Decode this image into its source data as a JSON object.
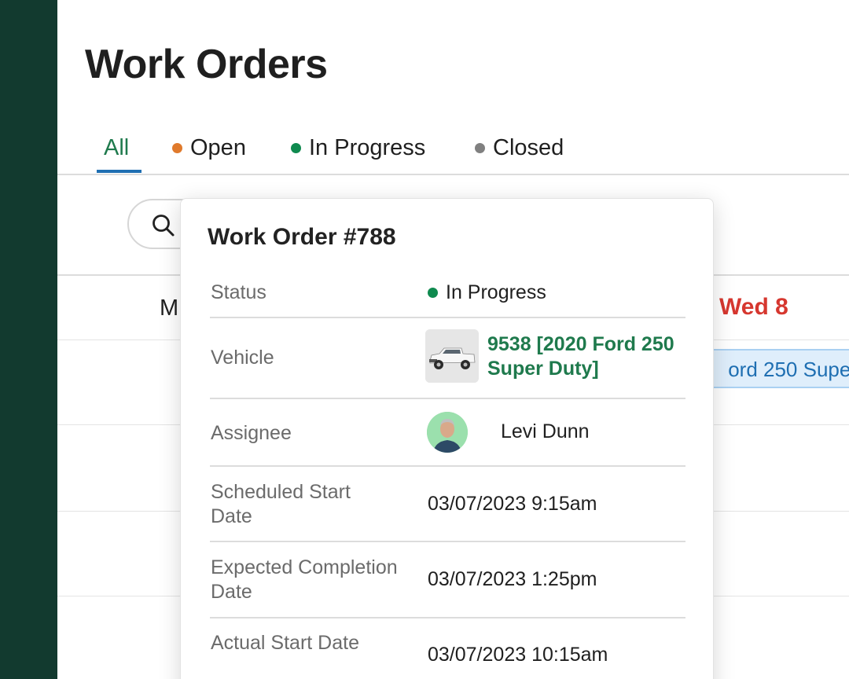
{
  "page": {
    "title": "Work Orders"
  },
  "tabs": [
    {
      "label": "All",
      "dot_color": null,
      "active": true
    },
    {
      "label": "Open",
      "dot_color": "#e07a2c",
      "active": false
    },
    {
      "label": "In Progress",
      "dot_color": "#0f8a4f",
      "active": false
    },
    {
      "label": "Closed",
      "dot_color": "#808080",
      "active": false
    }
  ],
  "search": {
    "icon": "search-icon"
  },
  "calendar": {
    "day_left_partial": "M",
    "day_wed": "Wed 8",
    "event_text": "ord 250 Super"
  },
  "popover": {
    "title": "Work Order #788",
    "rows": {
      "status": {
        "label": "Status",
        "value": "In Progress",
        "dot_color": "#0f8a4f"
      },
      "vehicle": {
        "label": "Vehicle",
        "value": "9538 [2020 Ford 250 Super Duty]",
        "thumb_icon": "pickup-truck-photo"
      },
      "assignee": {
        "label": "Assignee",
        "value": "Levi Dunn",
        "avatar": "avatar-photo"
      },
      "scheduled_start": {
        "label": "Scheduled Start Date",
        "value": "03/07/2023 9:15am"
      },
      "expected_completion": {
        "label": "Expected Completion Date",
        "value": "03/07/2023 1:25pm"
      },
      "actual_start": {
        "label": "Actual Start Date",
        "value": "03/07/2023 10:15am"
      }
    }
  },
  "colors": {
    "sidebar": "#123a2f",
    "accent_green": "#1f7a4d",
    "tab_underline": "#1f6fb2",
    "day_highlight": "#d6372f"
  }
}
